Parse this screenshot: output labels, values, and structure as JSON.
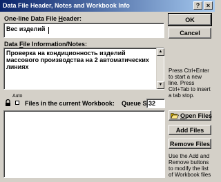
{
  "window": {
    "title": "Data File Header, Notes and Workbook Info",
    "help_glyph": "?",
    "close_glyph": "×"
  },
  "header": {
    "label_prefix": "One-line Data File ",
    "label_underlined": "H",
    "label_suffix": "eader:",
    "value": "Вес изделий"
  },
  "notes": {
    "label_prefix": "Data ",
    "label_underlined": "F",
    "label_suffix": "ile Information/Notes:",
    "value": "Проверка на кондиционность изделий\nмассового производства на 2 автоматических\nлиниях"
  },
  "buttons": {
    "ok": "OK",
    "cancel": "Cancel",
    "open_files_prefix": "",
    "open_files_underlined": "O",
    "open_files_suffix": "pen Files",
    "add_files": "Add Files",
    "remove_files": "Remove Files"
  },
  "hints": {
    "newline": "Press Ctrl+Enter to start a new line. Press Ctrl+Tab to insert a tab stop.",
    "workbook": "Use the Add and Remove buttons to modify the list of Workbook files"
  },
  "workbook": {
    "auto_label": "Auto",
    "files_label": "Files in the current Workbook:",
    "queue_label": "Queue Size:",
    "queue_value": "32"
  },
  "icons": {
    "lock": "lock-icon",
    "open_folder": "open-folder-icon"
  }
}
